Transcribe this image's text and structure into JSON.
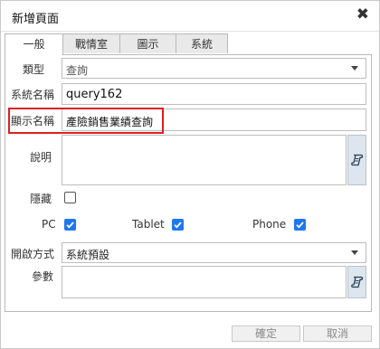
{
  "dialog": {
    "title": "新增頁面",
    "close_glyph": "✖"
  },
  "tabs": [
    {
      "label": "一般",
      "active": true
    },
    {
      "label": "戰情室",
      "active": false
    },
    {
      "label": "圖示",
      "active": false
    },
    {
      "label": "系統",
      "active": false
    }
  ],
  "form": {
    "type": {
      "label": "類型",
      "value": "查詢"
    },
    "system_name": {
      "label": "系統名稱",
      "value": "query162"
    },
    "display_name": {
      "label": "顯示名稱",
      "value": "產險銷售業績查詢"
    },
    "description": {
      "label": "說明",
      "value": ""
    },
    "hidden": {
      "label": "隱藏",
      "checked": false
    },
    "pc": {
      "label": "PC",
      "checked": true
    },
    "tablet": {
      "label": "Tablet",
      "checked": true
    },
    "phone": {
      "label": "Phone",
      "checked": true
    },
    "open_mode": {
      "label": "開啟方式",
      "value": "系統預設"
    },
    "params": {
      "label": "參數",
      "value": ""
    }
  },
  "footer": {
    "confirm": "確定",
    "cancel": "取消"
  },
  "colors": {
    "highlight": "#dd2020",
    "checkbox": "#1e78f0",
    "editor_button": "#dde6ef"
  },
  "icons": {
    "editor_button": "script-edit-icon"
  }
}
